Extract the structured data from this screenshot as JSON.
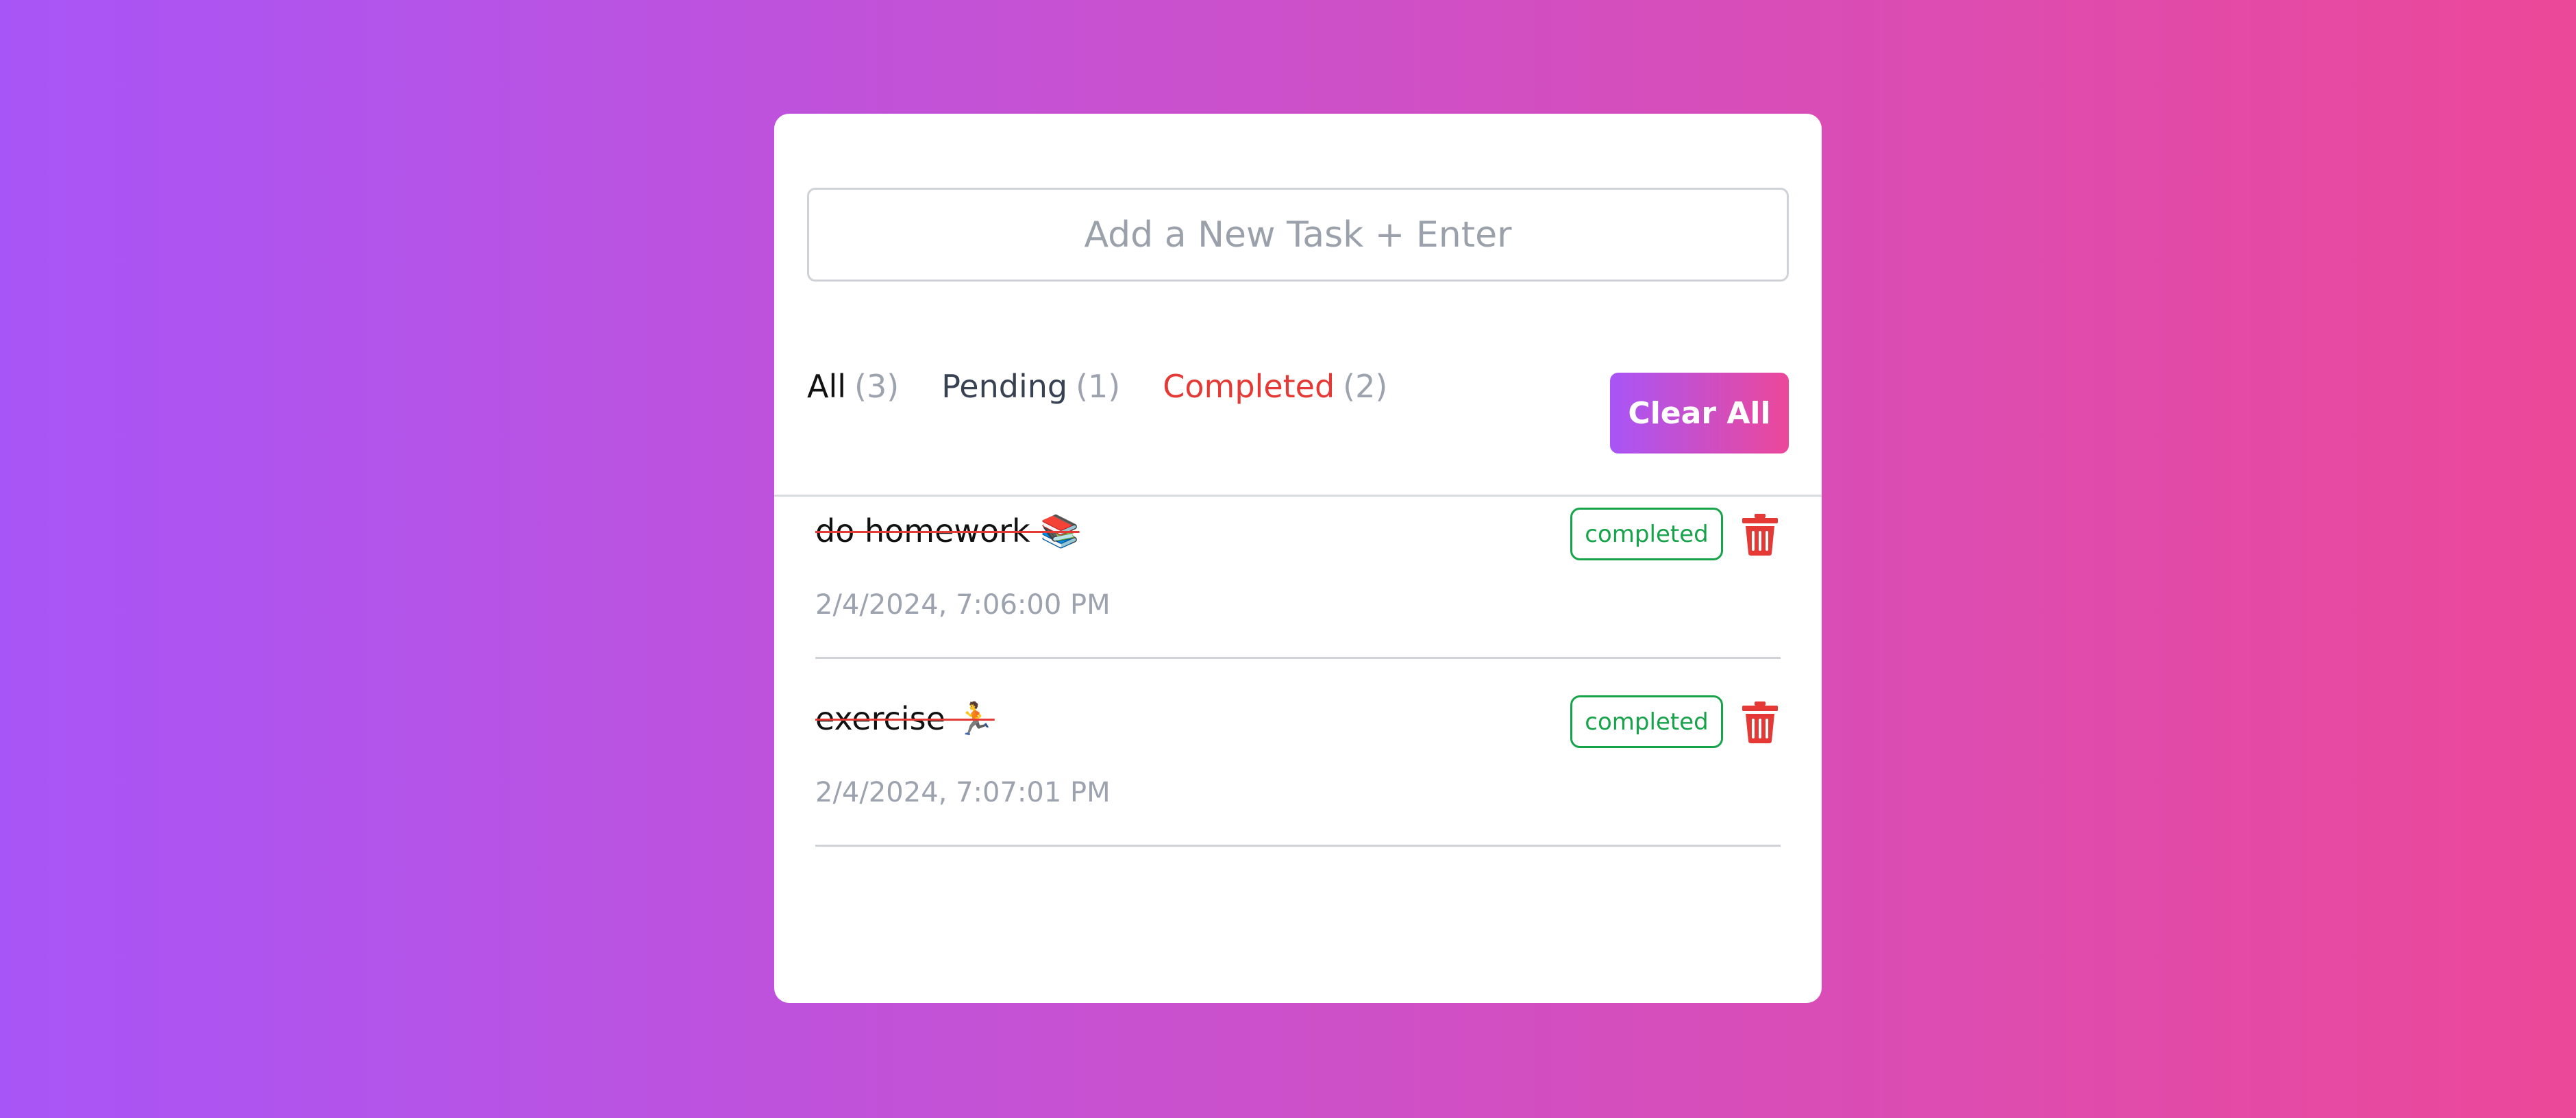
{
  "input": {
    "placeholder": "Add a New Task + Enter"
  },
  "filters": [
    {
      "label": "All",
      "count": "(3)"
    },
    {
      "label": "Pending",
      "count": "(1)"
    },
    {
      "label": "Completed",
      "count": "(2)"
    }
  ],
  "clear_all_label": "Clear All",
  "tasks": [
    {
      "text": "do homework 📚",
      "time": "2/4/2024, 7:06:00 PM",
      "status": "completed"
    },
    {
      "text": "exercise 🏃",
      "time": "2/4/2024, 7:07:01 PM",
      "status": "completed"
    }
  ],
  "colors": {
    "accent_gradient_start": "#a855f7",
    "accent_gradient_end": "#ec4899",
    "active_filter": "#e53935",
    "completed": "#16a34a",
    "delete": "#e53935"
  },
  "icons": [
    "trash-icon"
  ]
}
